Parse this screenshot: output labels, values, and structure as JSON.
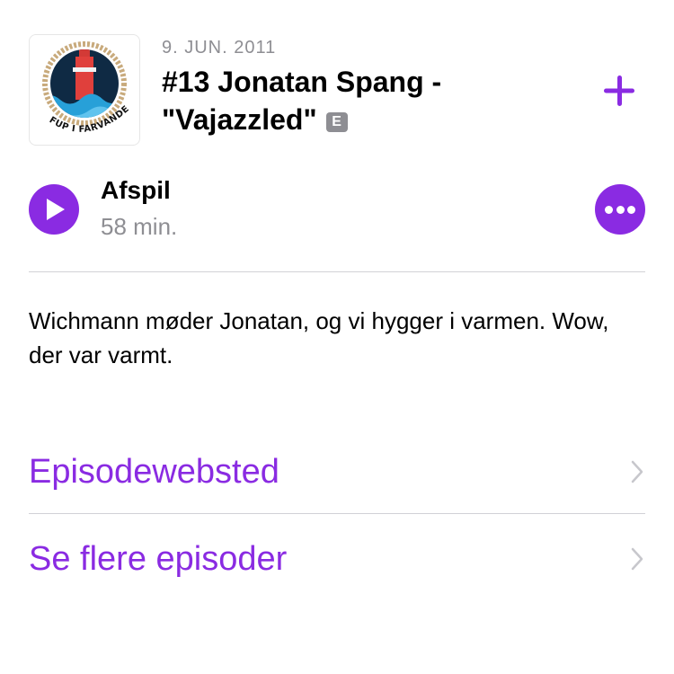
{
  "episode": {
    "date": "9. JUN. 2011",
    "title_line1": "#13 Jonatan Spang -",
    "title_line2": "\"Vajazzled\"",
    "explicit_badge": "E",
    "description": "Wichmann møder Jonatan, og vi hygger i varmen. Wow, der var varmt."
  },
  "artwork": {
    "logo_text": "FUP I FARVANDET",
    "icon": "lighthouse-in-waves-icon"
  },
  "playback": {
    "play_label": "Afspil",
    "duration": "58 min.",
    "play_icon": "play-icon",
    "more_icon": "more-ellipsis-icon"
  },
  "actions": {
    "add_icon": "plus-icon"
  },
  "links": [
    {
      "label": "Episodewebsted",
      "icon": "chevron-right-icon"
    },
    {
      "label": "Se flere episoder",
      "icon": "chevron-right-icon"
    }
  ],
  "colors": {
    "accent": "#8a2be2",
    "secondary_text": "#8e8e93",
    "divider": "#d1d1d6",
    "artwork_circle": "#0f2a44",
    "artwork_water": "#27a0d8",
    "artwork_lighthouse": "#e0403c",
    "artwork_rope": "#c8aa7c"
  }
}
